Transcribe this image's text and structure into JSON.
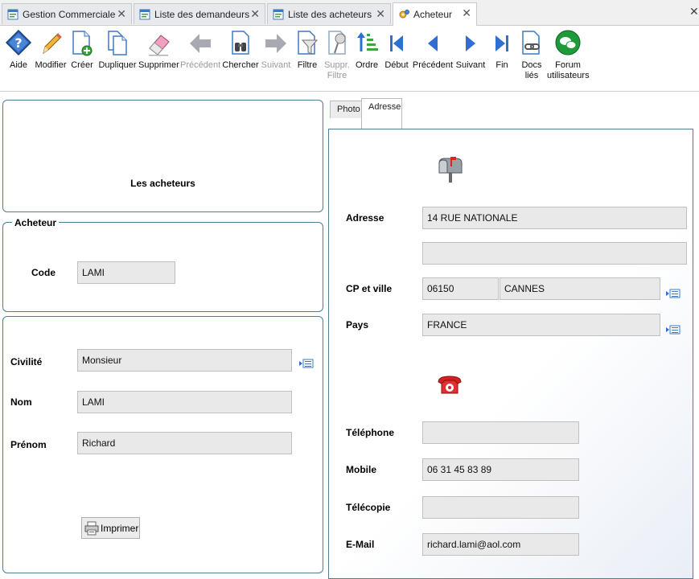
{
  "tabs": [
    {
      "label": "Gestion Commerciale"
    },
    {
      "label": "Liste des demandeurs"
    },
    {
      "label": "Liste des acheteurs"
    },
    {
      "label": "Acheteur"
    }
  ],
  "toolbar": {
    "aide": "Aide",
    "modifier": "Modifier",
    "creer": "Créer",
    "dupliquer": "Dupliquer",
    "supprimer": "Supprimer",
    "precedent_disabled": "Précédent",
    "chercher": "Chercher",
    "suivant_disabled": "Suivant",
    "filtre": "Filtre",
    "suppr_filtre_line1": "Suppr.",
    "suppr_filtre_line2": "Filtre",
    "ordre": "Ordre",
    "debut": "Début",
    "precedent": "Précédent",
    "suivant": "Suivant",
    "fin": "Fin",
    "docs_line1": "Docs",
    "docs_line2": "liés",
    "forum_line1": "Forum",
    "forum_line2": "utilisateurs"
  },
  "header_panel": {
    "title": "Les acheteurs"
  },
  "acheteur": {
    "legend": "Acheteur",
    "code_label": "Code",
    "code_value": "LAMI"
  },
  "identity": {
    "civilite_label": "Civilité",
    "civilite_value": "Monsieur",
    "nom_label": "Nom",
    "nom_value": "LAMI",
    "prenom_label": "Prénom",
    "prenom_value": "Richard",
    "print_label": "Imprimer"
  },
  "right_tabs": {
    "photo": "Photo",
    "adresse": "Adresse"
  },
  "address": {
    "adresse_label": "Adresse",
    "adresse_line1": "14 RUE NATIONALE",
    "adresse_line2": "",
    "cp_ville_label": "CP et ville",
    "cp": "06150",
    "ville": "CANNES",
    "pays_label": "Pays",
    "pays": "FRANCE",
    "telephone_label": "Téléphone",
    "telephone": "",
    "mobile_label": "Mobile",
    "mobile": "06 31 45 83 89",
    "telecopie_label": "Télécopie",
    "telecopie": "",
    "email_label": "E-Mail",
    "email": "richard.lami@aol.com"
  },
  "colors": {
    "panel_border": "#4d7e92",
    "field_bg": "#e9e9e9",
    "help_blue": "#2b63b8",
    "nav_blue": "#2f6fd1",
    "forum_green": "#1f9a3a",
    "phone_red": "#d62020"
  }
}
